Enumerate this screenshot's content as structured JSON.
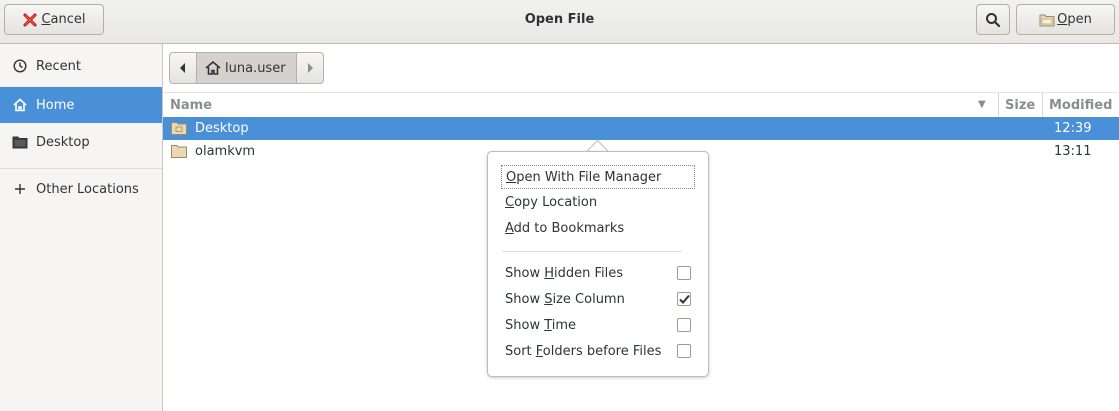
{
  "header": {
    "title": "Open File",
    "cancel_label": "Cancel",
    "cancel_mnemonic": "C",
    "cancel_rest": "ancel",
    "open_label": "Open",
    "open_mnemonic": "O",
    "open_rest": "pen"
  },
  "sidebar": {
    "items": [
      {
        "label": "Recent",
        "icon": "clock-icon"
      },
      {
        "label": "Home",
        "icon": "home-icon",
        "active": true
      },
      {
        "label": "Desktop",
        "icon": "desktop-icon"
      },
      {
        "label": "Other Locations",
        "icon": "plus-icon"
      }
    ]
  },
  "pathbar": {
    "crumb": "luna.user"
  },
  "filelist": {
    "columns": {
      "name": "Name",
      "size": "Size",
      "modified": "Modified"
    },
    "rows": [
      {
        "name": "Desktop",
        "size": "",
        "modified": "12:39",
        "selected": true
      },
      {
        "name": "olamkvm",
        "size": "",
        "modified": "13:11",
        "selected": false
      }
    ]
  },
  "menu": {
    "items": [
      {
        "pre": "",
        "mn": "O",
        "post": "pen With File Manager"
      },
      {
        "pre": "",
        "mn": "C",
        "post": "opy Location"
      },
      {
        "pre": "",
        "mn": "A",
        "post": "dd to Bookmarks"
      }
    ],
    "toggles": [
      {
        "pre": "Show ",
        "mn": "H",
        "post": "idden Files",
        "checked": false
      },
      {
        "pre": "Show ",
        "mn": "S",
        "post": "ize Column",
        "checked": true
      },
      {
        "pre": "Show ",
        "mn": "T",
        "post": "ime",
        "checked": false
      },
      {
        "pre": "Sort ",
        "mn": "F",
        "post": "olders before Files",
        "checked": false
      }
    ]
  },
  "colors": {
    "selection": "#4a90d9",
    "cancel_x": "#cc0000"
  }
}
